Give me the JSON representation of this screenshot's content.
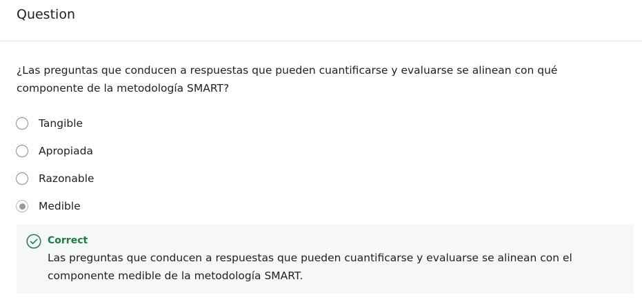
{
  "header": {
    "title": "Question"
  },
  "question": {
    "text": "¿Las preguntas que conducen a respuestas que pueden cuantificarse y evaluarse se alinean con qué componente de la metodología SMART?"
  },
  "options": [
    {
      "label": "Tangible",
      "selected": false
    },
    {
      "label": "Apropiada",
      "selected": false
    },
    {
      "label": "Razonable",
      "selected": false
    },
    {
      "label": "Medible",
      "selected": true
    }
  ],
  "feedback": {
    "icon": "check-circle-icon",
    "status": "Correct",
    "text": "Las preguntas que conducen a respuestas que pueden cuantificarse y evaluarse se alinean con el componente medible de la metodología SMART."
  },
  "colors": {
    "correct": "#1e7b47",
    "feedback_bg": "#f5f8f6",
    "divider": "#e1e1e1"
  }
}
